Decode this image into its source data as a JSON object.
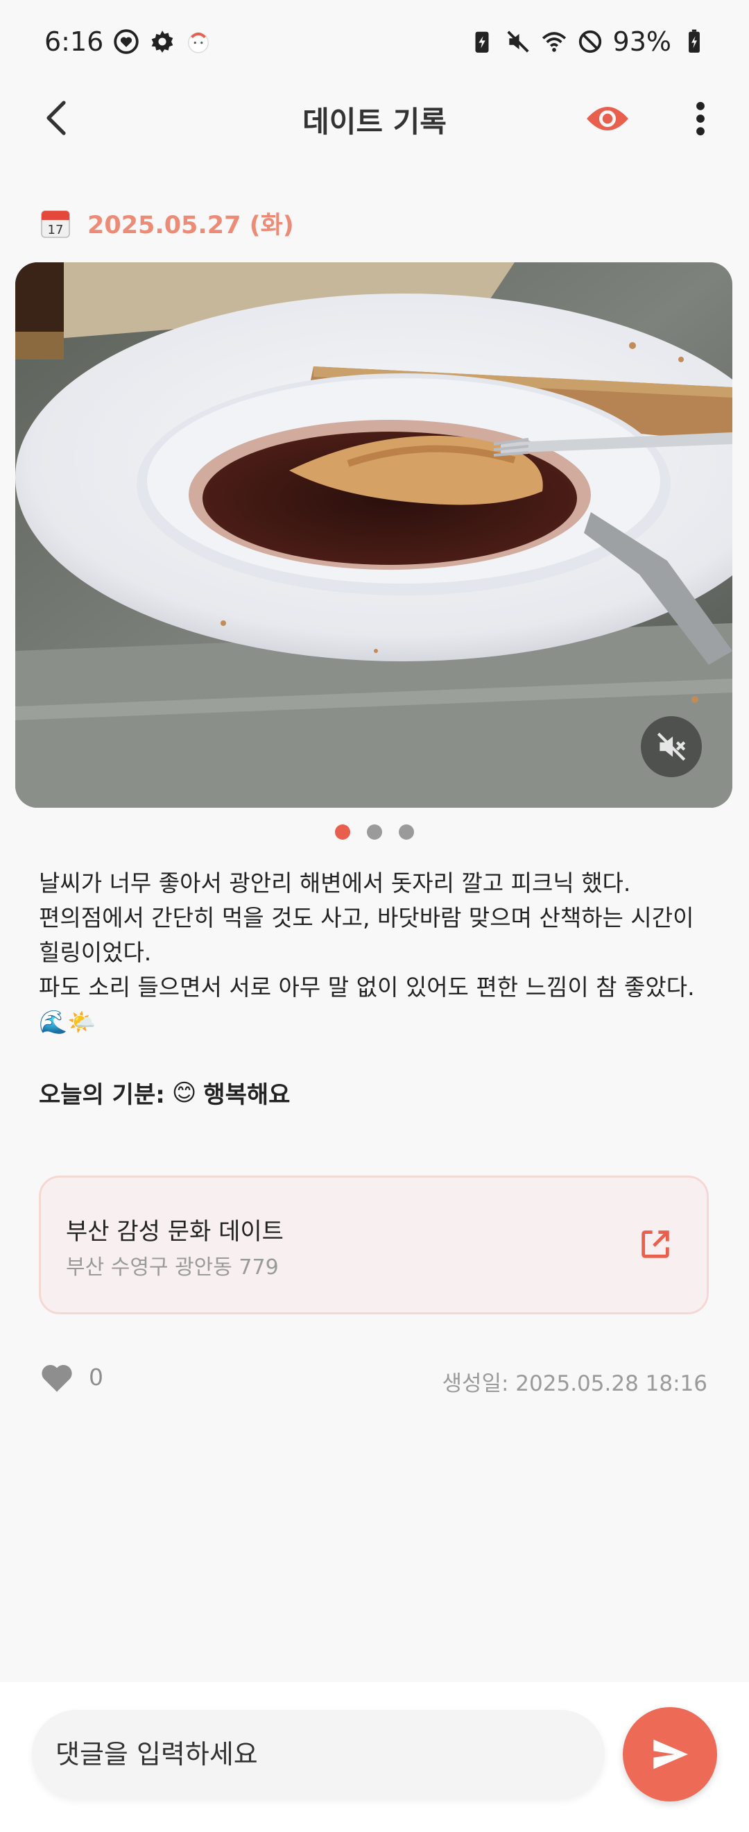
{
  "status_bar": {
    "time": "6:16",
    "battery": "93%"
  },
  "app_bar": {
    "title": "데이트 기록",
    "accent": "#e8604d"
  },
  "post": {
    "date": "2025.05.27 (화)",
    "calendar_day": "17",
    "image_description_icon": "photo",
    "carousel": {
      "count": 3,
      "active_index": 0
    },
    "body_lines": [
      "날씨가 너무 좋아서 광안리 해변에서 돗자리 깔고 피크닉 했다.",
      "편의점에서 간단히 먹을 것도 사고, 바닷바람 맞으며 산책하는 시간이",
      "힐링이었다.",
      "파도 소리 들으면서 서로 아무 말 없이 있어도 편한 느낌이 참 좋았다.",
      "🌊🌤️"
    ],
    "mood_label": "오늘의 기분:",
    "mood_emoji": "😊",
    "mood_text": "행복해요"
  },
  "place": {
    "name": "부산 감성 문화 데이트",
    "address": "부산 수영구 광안동 779"
  },
  "meta": {
    "like_count": "0",
    "created": "생성일: 2025.05.28 18:16"
  },
  "comment": {
    "placeholder": "댓글을 입력하세요"
  },
  "colors": {
    "date": "#ec8b76",
    "dot_active": "#e8604d",
    "dot_inactive": "#9a9a9a",
    "card_bg": "#f8f0f0",
    "card_border": "#f6d8d3",
    "send_button": "#ec6a56"
  }
}
